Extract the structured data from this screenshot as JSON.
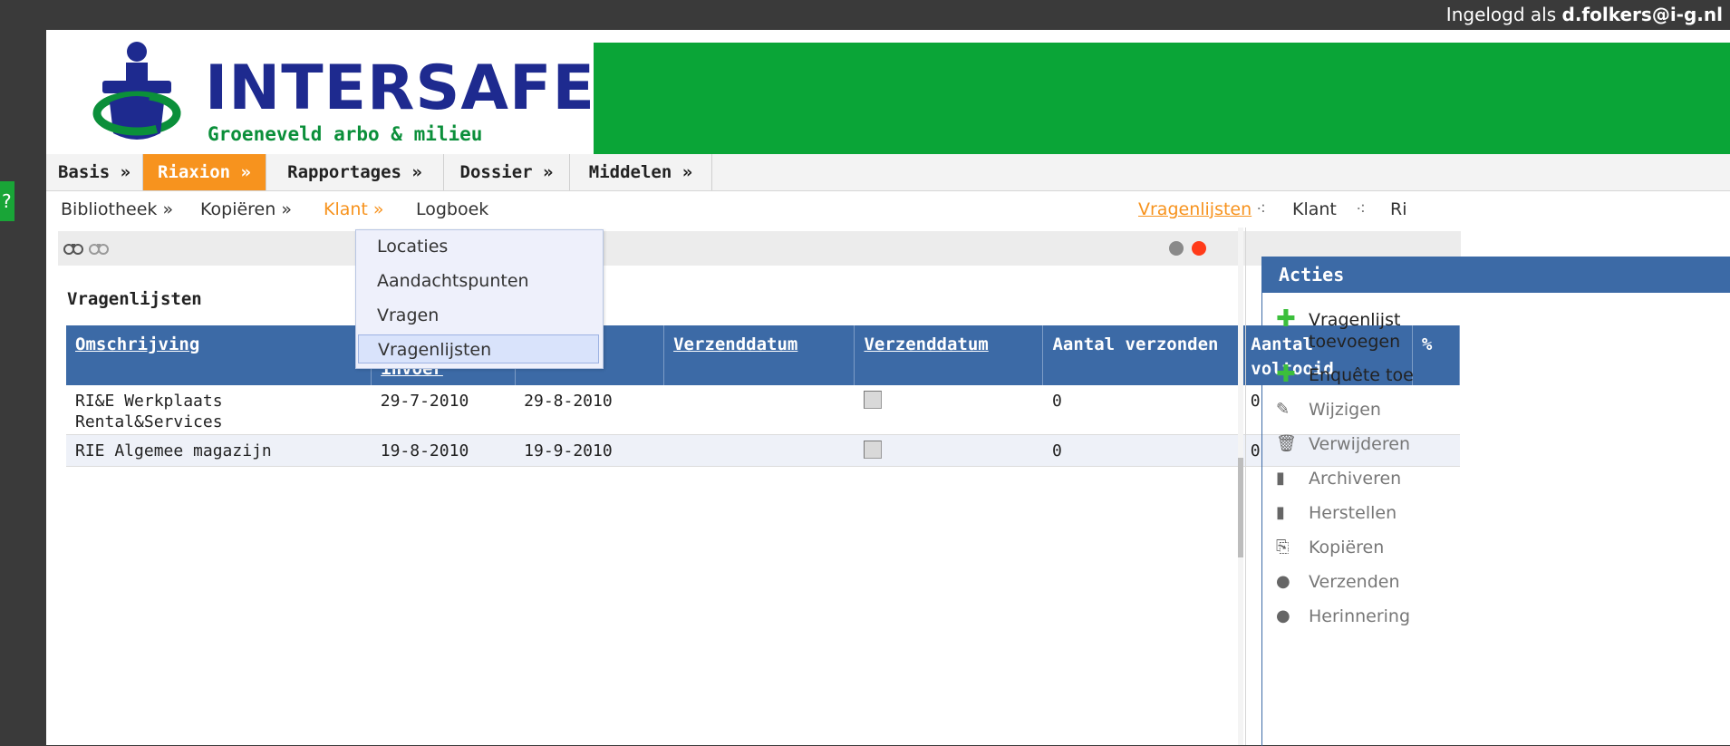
{
  "header": {
    "user_prefix": "Ingelogd als",
    "user_name": "d.folkers@i-g.nl"
  },
  "help_tab": "?",
  "logo": {
    "title": "INTERSAFE",
    "subtitle": "Groeneveld arbo & milieu"
  },
  "nav_main": [
    {
      "label": "Basis »"
    },
    {
      "label": "Riaxion »"
    },
    {
      "label": "Rapportages »"
    },
    {
      "label": "Dossier »"
    },
    {
      "label": "Middelen »"
    }
  ],
  "nav_sub": [
    {
      "label": "Bibliotheek »"
    },
    {
      "label": "Kopiëren »"
    },
    {
      "label": "Klant »"
    },
    {
      "label": "Logboek"
    }
  ],
  "breadcrumb": [
    {
      "label": "Vragenlijsten"
    },
    {
      "label": "Klant"
    },
    {
      "label": "Ri"
    }
  ],
  "toolbar": {
    "icons": [
      "binoculars-icon",
      "binoculars-gray-icon"
    ],
    "status_colors": [
      "#8a8a8a",
      "#ff3b1a"
    ]
  },
  "dropdown": {
    "items": [
      "Locaties",
      "Aandachtspunten",
      "Vragen",
      "Vragenlijsten"
    ],
    "highlighted": "Vragenlijsten"
  },
  "content": {
    "title": "Vragenlijsten",
    "columns": [
      {
        "label": "Omschrijving"
      },
      {
        "label": "invoer"
      },
      {
        "label": ""
      },
      {
        "label": "Verzenddatum"
      },
      {
        "label": "Verzenddatum"
      },
      {
        "label": "Aantal verzonden"
      },
      {
        "label": "Aantal voltooid"
      },
      {
        "label": "%"
      }
    ],
    "rows": [
      {
        "omschrijving": "RI&E Werkplaats Rental&Services",
        "datum1": "29-7-2010",
        "datum2": "29-8-2010",
        "aantal_verzonden": "0",
        "aantal_voltooid": "0"
      },
      {
        "omschrijving": "RIE Algemee magazijn",
        "datum1": "19-8-2010",
        "datum2": "19-9-2010",
        "aantal_verzonden": "0",
        "aantal_voltooid": "0"
      }
    ]
  },
  "acties": {
    "title": "Acties",
    "items": [
      {
        "label": "Vragenlijst toevoegen",
        "icon": "plus-icon",
        "enabled": true
      },
      {
        "label": "Enquête toe",
        "icon": "plus-icon",
        "enabled": true
      },
      {
        "label": "Wijzigen",
        "icon": "edit-icon",
        "enabled": false
      },
      {
        "label": "Verwijderen",
        "icon": "trash-icon",
        "enabled": false
      },
      {
        "label": "Archiveren",
        "icon": "archive-icon",
        "enabled": false
      },
      {
        "label": "Herstellen",
        "icon": "restore-icon",
        "enabled": false
      },
      {
        "label": "Kopiëren",
        "icon": "copy-icon",
        "enabled": false
      },
      {
        "label": "Verzenden",
        "icon": "send-icon",
        "enabled": false
      },
      {
        "label": "Herinnering",
        "icon": "reminder-icon",
        "enabled": false
      }
    ]
  },
  "colors": {
    "brand_green": "#0aa537",
    "accent_orange": "#f7931e",
    "header_blue": "#3c6aa6",
    "logo_blue": "#1e2a8f"
  }
}
